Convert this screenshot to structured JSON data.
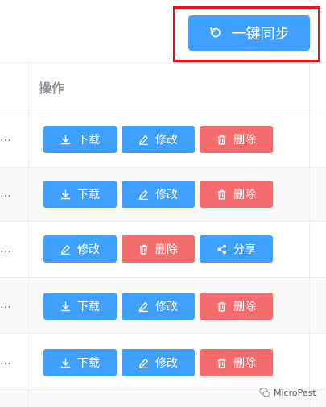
{
  "toolbar": {
    "sync_label": "一键同步"
  },
  "table": {
    "operation_header": "操作",
    "row_ellipsis": "…",
    "rows": [
      {
        "buttons": [
          {
            "label": "下载",
            "icon": "download-icon",
            "color": "#40a0ff"
          },
          {
            "label": "修改",
            "icon": "edit-icon",
            "color": "#40a0ff"
          },
          {
            "label": "删除",
            "icon": "delete-icon",
            "color": "#f56c6c"
          }
        ]
      },
      {
        "buttons": [
          {
            "label": "下载",
            "icon": "download-icon",
            "color": "#40a0ff"
          },
          {
            "label": "修改",
            "icon": "edit-icon",
            "color": "#40a0ff"
          },
          {
            "label": "删除",
            "icon": "delete-icon",
            "color": "#f56c6c"
          }
        ]
      },
      {
        "buttons": [
          {
            "label": "修改",
            "icon": "edit-icon",
            "color": "#40a0ff"
          },
          {
            "label": "删除",
            "icon": "delete-icon",
            "color": "#f56c6c"
          },
          {
            "label": "分享",
            "icon": "share-icon",
            "color": "#40a0ff"
          }
        ]
      },
      {
        "buttons": [
          {
            "label": "下载",
            "icon": "download-icon",
            "color": "#40a0ff"
          },
          {
            "label": "修改",
            "icon": "edit-icon",
            "color": "#40a0ff"
          },
          {
            "label": "删除",
            "icon": "delete-icon",
            "color": "#f56c6c"
          }
        ]
      },
      {
        "buttons": [
          {
            "label": "下载",
            "icon": "download-icon",
            "color": "#40a0ff"
          },
          {
            "label": "修改",
            "icon": "edit-icon",
            "color": "#40a0ff"
          },
          {
            "label": "删除",
            "icon": "delete-icon",
            "color": "#f56c6c"
          }
        ]
      }
    ]
  },
  "watermark": {
    "text": "MicroPest"
  },
  "colors": {
    "primary": "#40a0ff",
    "danger": "#f56c6c",
    "highlight": "#e8101a"
  }
}
